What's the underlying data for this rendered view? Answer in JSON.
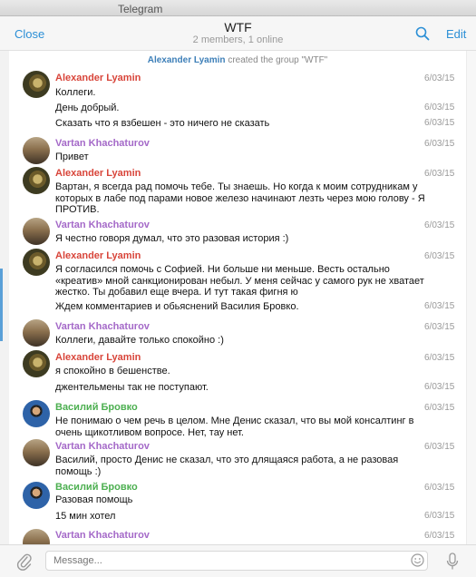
{
  "window": {
    "title": "Telegram"
  },
  "header": {
    "close_label": "Close",
    "title": "WTF",
    "subtitle": "2 members, 1 online",
    "edit_label": "Edit"
  },
  "service_message": {
    "actor": "Alexander Lyamin",
    "text": "created the group \"WTF\""
  },
  "messages": [
    {
      "author": "Alexander Lyamin",
      "text": "Коллеги.",
      "time": "6/03/15"
    },
    {
      "text": "День добрый.",
      "time": "6/03/15"
    },
    {
      "text": "Сказать что я взбешен - это ничего не сказать",
      "time": "6/03/15"
    },
    {
      "author": "Vartan Khachaturov",
      "text": "Привет",
      "time": "6/03/15"
    },
    {
      "author": "Alexander Lyamin",
      "text": "Вартан, я всегда рад помочь тебе. Ты знаешь. Но когда к моим сотрудникам у которых в лабе под парами новое железо начинают лезть через мою голову - Я ПРОТИВ.",
      "time": "6/03/15"
    },
    {
      "author": "Vartan Khachaturov",
      "text": "Я честно говоря думал, что это разовая история :)",
      "time": "6/03/15"
    },
    {
      "author": "Alexander Lyamin",
      "text": "Я согласился помочь с Софией. Ни больше ни меньше. Весть остально «креатив» мной санкционирован небыл. У меня сейчас у самого рук не хватает жестко. Ты добавил еще вчера. И тут такая фигня ю",
      "time": "6/03/15"
    },
    {
      "text": "Ждем комментариев и обьяснений Василия Бровко.",
      "time": "6/03/15"
    },
    {
      "author": "Vartan Khachaturov",
      "text": "Коллеги, давайте только спокойно :)",
      "time": "6/03/15"
    },
    {
      "author": "Alexander Lyamin",
      "text": "я спокойно в бешенстве.",
      "time": "6/03/15"
    },
    {
      "text": "джентельмены так не поступают.",
      "time": "6/03/15"
    },
    {
      "author": "Василий Бровко",
      "text": "Не понимаю о чем речь в целом. Мне Денис сказал, что вы мой консалтинг в очень щикотливом вопросе. Нет, тау нет.",
      "time": "6/03/15"
    },
    {
      "author": "Vartan Khachaturov",
      "text": "Василий, просто Денис не сказал, что это длящаяся работа, а не разовая помощь :)",
      "time": "6/03/15"
    },
    {
      "author": "Василий Бровко",
      "text": "Разовая помощь",
      "time": "6/03/15"
    },
    {
      "text": "15 мин хотел",
      "time": "6/03/15"
    },
    {
      "author": "Vartan Khachaturov",
      "text": "",
      "time": "6/03/15"
    }
  ],
  "composer": {
    "placeholder": "Message..."
  },
  "icons": {
    "search": "search-icon",
    "attach": "paperclip-icon",
    "emoji": "smiley-icon",
    "mic": "microphone-icon"
  },
  "colors": {
    "accent": "#2b8fd6",
    "alexander": "#d8453a",
    "vartan": "#a469c8",
    "vasily": "#4caf50"
  }
}
